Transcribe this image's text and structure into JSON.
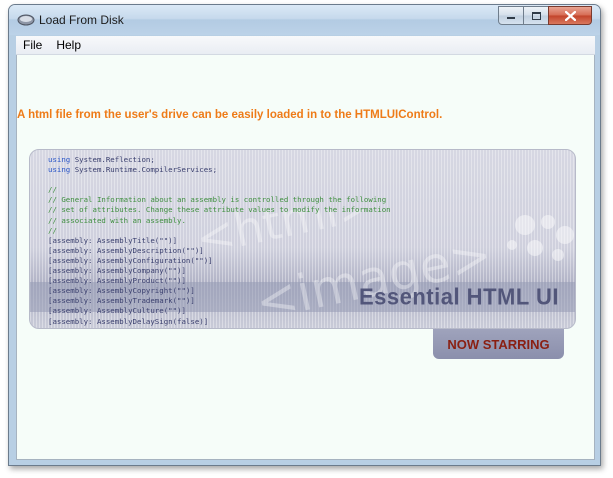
{
  "window": {
    "title": "Load From Disk"
  },
  "menu": {
    "items": [
      "File",
      "Help"
    ]
  },
  "content": {
    "intro_text": "A html file from the user's drive can be easily loaded in to the HTMLUIControl.",
    "banner": {
      "code_lines": [
        {
          "kind": "using",
          "kw": "using",
          "text": " System.Reflection;"
        },
        {
          "kind": "using",
          "kw": "using",
          "text": " System.Runtime.CompilerServices;"
        },
        {
          "kind": "blank",
          "kw": "",
          "text": ""
        },
        {
          "kind": "comment",
          "kw": "",
          "text": "//"
        },
        {
          "kind": "comment",
          "kw": "",
          "text": "// General Information about an assembly is controlled through the following"
        },
        {
          "kind": "comment",
          "kw": "",
          "text": "// set of attributes. Change these attribute values to modify the information"
        },
        {
          "kind": "comment",
          "kw": "",
          "text": "// associated with an assembly."
        },
        {
          "kind": "comment",
          "kw": "",
          "text": "//"
        },
        {
          "kind": "code",
          "kw": "",
          "text": "[assembly: AssemblyTitle(\"\")]"
        },
        {
          "kind": "code",
          "kw": "",
          "text": "[assembly: AssemblyDescription(\"\")]"
        },
        {
          "kind": "code",
          "kw": "",
          "text": "[assembly: AssemblyConfiguration(\"\")]"
        },
        {
          "kind": "code",
          "kw": "",
          "text": "[assembly: AssemblyCompany(\"\")]"
        },
        {
          "kind": "code",
          "kw": "",
          "text": "[assembly: AssemblyProduct(\"\")]"
        },
        {
          "kind": "code",
          "kw": "",
          "text": "[assembly: AssemblyCopyright(\"\")]"
        },
        {
          "kind": "code",
          "kw": "",
          "text": "[assembly: AssemblyTrademark(\"\")]"
        },
        {
          "kind": "code",
          "kw": "",
          "text": "[assembly: AssemblyCulture(\"\")]"
        },
        {
          "kind": "code",
          "kw": "",
          "text": "[assembly: AssemblyDelaySign(false)]"
        }
      ],
      "watermark": "<html> <image>",
      "title": "Essential HTML UI",
      "tab_label": "NOW STARRING"
    }
  },
  "colors": {
    "intro": "#ee7b18",
    "tab_text": "#8a1f12",
    "banner_title": "#52567a"
  },
  "icons": {
    "app": "drive-icon",
    "minimize": "minimize-icon",
    "maximize": "maximize-icon",
    "close": "close-icon"
  }
}
